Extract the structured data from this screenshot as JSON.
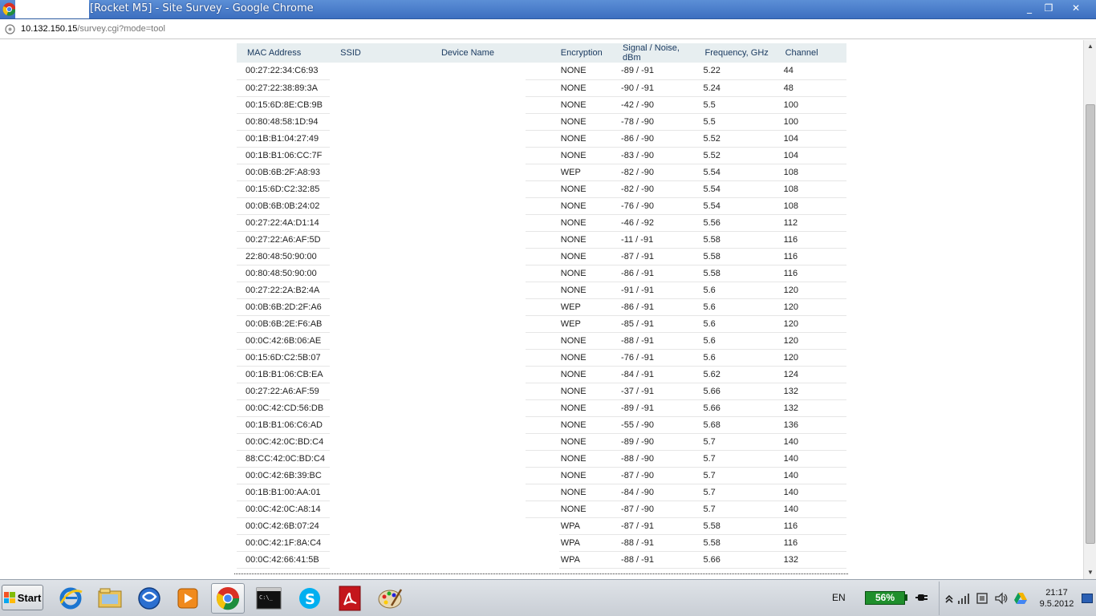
{
  "window": {
    "title": "[Rocket M5] - Site Survey - Google Chrome",
    "minimize": "_",
    "restore": "❐",
    "close": "✕"
  },
  "address": {
    "host": "10.132.150.15",
    "path": "/survey.cgi?mode=tool"
  },
  "table": {
    "headers": [
      "MAC Address",
      "SSID",
      "Device Name",
      "Encryption",
      "Signal / Noise, dBm",
      "Frequency, GHz",
      "Channel"
    ],
    "rows": [
      {
        "mac": "00:27:22:34:C6:93",
        "enc": "NONE",
        "sig": "-89 / -91",
        "freq": "5.22",
        "ch": "44"
      },
      {
        "mac": "00:27:22:38:89:3A",
        "enc": "NONE",
        "sig": "-90 / -91",
        "freq": "5.24",
        "ch": "48"
      },
      {
        "mac": "00:15:6D:8E:CB:9B",
        "enc": "NONE",
        "sig": "-42 / -90",
        "freq": "5.5",
        "ch": "100"
      },
      {
        "mac": "00:80:48:58:1D:94",
        "enc": "NONE",
        "sig": "-78 / -90",
        "freq": "5.5",
        "ch": "100"
      },
      {
        "mac": "00:1B:B1:04:27:49",
        "enc": "NONE",
        "sig": "-86 / -90",
        "freq": "5.52",
        "ch": "104"
      },
      {
        "mac": "00:1B:B1:06:CC:7F",
        "enc": "NONE",
        "sig": "-83 / -90",
        "freq": "5.52",
        "ch": "104"
      },
      {
        "mac": "00:0B:6B:2F:A8:93",
        "enc": "WEP",
        "sig": "-82 / -90",
        "freq": "5.54",
        "ch": "108"
      },
      {
        "mac": "00:15:6D:C2:32:85",
        "enc": "NONE",
        "sig": "-82 / -90",
        "freq": "5.54",
        "ch": "108"
      },
      {
        "mac": "00:0B:6B:0B:24:02",
        "enc": "NONE",
        "sig": "-76 / -90",
        "freq": "5.54",
        "ch": "108"
      },
      {
        "mac": "00:27:22:4A:D1:14",
        "enc": "NONE",
        "sig": "-46 / -92",
        "freq": "5.56",
        "ch": "112"
      },
      {
        "mac": "00:27:22:A6:AF:5D",
        "enc": "NONE",
        "sig": "-11 / -91",
        "freq": "5.58",
        "ch": "116"
      },
      {
        "mac": "22:80:48:50:90:00",
        "enc": "NONE",
        "sig": "-87 / -91",
        "freq": "5.58",
        "ch": "116"
      },
      {
        "mac": "00:80:48:50:90:00",
        "enc": "NONE",
        "sig": "-86 / -91",
        "freq": "5.58",
        "ch": "116"
      },
      {
        "mac": "00:27:22:2A:B2:4A",
        "enc": "NONE",
        "sig": "-91 / -91",
        "freq": "5.6",
        "ch": "120"
      },
      {
        "mac": "00:0B:6B:2D:2F:A6",
        "enc": "WEP",
        "sig": "-86 / -91",
        "freq": "5.6",
        "ch": "120"
      },
      {
        "mac": "00:0B:6B:2E:F6:AB",
        "enc": "WEP",
        "sig": "-85 / -91",
        "freq": "5.6",
        "ch": "120"
      },
      {
        "mac": "00:0C:42:6B:06:AE",
        "enc": "NONE",
        "sig": "-88 / -91",
        "freq": "5.6",
        "ch": "120"
      },
      {
        "mac": "00:15:6D:C2:5B:07",
        "enc": "NONE",
        "sig": "-76 / -91",
        "freq": "5.6",
        "ch": "120"
      },
      {
        "mac": "00:1B:B1:06:CB:EA",
        "enc": "NONE",
        "sig": "-84 / -91",
        "freq": "5.62",
        "ch": "124"
      },
      {
        "mac": "00:27:22:A6:AF:59",
        "enc": "NONE",
        "sig": "-37 / -91",
        "freq": "5.66",
        "ch": "132"
      },
      {
        "mac": "00:0C:42:CD:56:DB",
        "enc": "NONE",
        "sig": "-89 / -91",
        "freq": "5.66",
        "ch": "132"
      },
      {
        "mac": "00:1B:B1:06:C6:AD",
        "enc": "NONE",
        "sig": "-55 / -90",
        "freq": "5.68",
        "ch": "136"
      },
      {
        "mac": "00:0C:42:0C:BD:C4",
        "enc": "NONE",
        "sig": "-89 / -90",
        "freq": "5.7",
        "ch": "140"
      },
      {
        "mac": "88:CC:42:0C:BD:C4",
        "enc": "NONE",
        "sig": "-88 / -90",
        "freq": "5.7",
        "ch": "140"
      },
      {
        "mac": "00:0C:42:6B:39:BC",
        "enc": "NONE",
        "sig": "-87 / -90",
        "freq": "5.7",
        "ch": "140"
      },
      {
        "mac": "00:1B:B1:00:AA:01",
        "enc": "NONE",
        "sig": "-84 / -90",
        "freq": "5.7",
        "ch": "140"
      },
      {
        "mac": "00:0C:42:0C:A8:14",
        "enc": "NONE",
        "sig": "-87 / -90",
        "freq": "5.7",
        "ch": "140"
      },
      {
        "mac": "00:0C:42:6B:07:24",
        "enc": "WPA",
        "sig": "-87 / -91",
        "freq": "5.58",
        "ch": "116"
      },
      {
        "mac": "00:0C:42:1F:8A:C4",
        "enc": "WPA",
        "sig": "-88 / -91",
        "freq": "5.58",
        "ch": "116"
      },
      {
        "mac": "00:0C:42:66:41:5B",
        "enc": "WPA",
        "sig": "-88 / -91",
        "freq": "5.66",
        "ch": "132"
      }
    ]
  },
  "taskbar": {
    "start_label": "Start",
    "language": "EN",
    "battery": "56%",
    "time": "21:17",
    "date": "9.5.2012",
    "apps": [
      "ie-icon",
      "explorer-icon",
      "skype-old-icon",
      "media-player-icon",
      "chrome-icon",
      "cmd-icon",
      "skype-icon",
      "acrobat-icon",
      "paint-icon"
    ]
  }
}
